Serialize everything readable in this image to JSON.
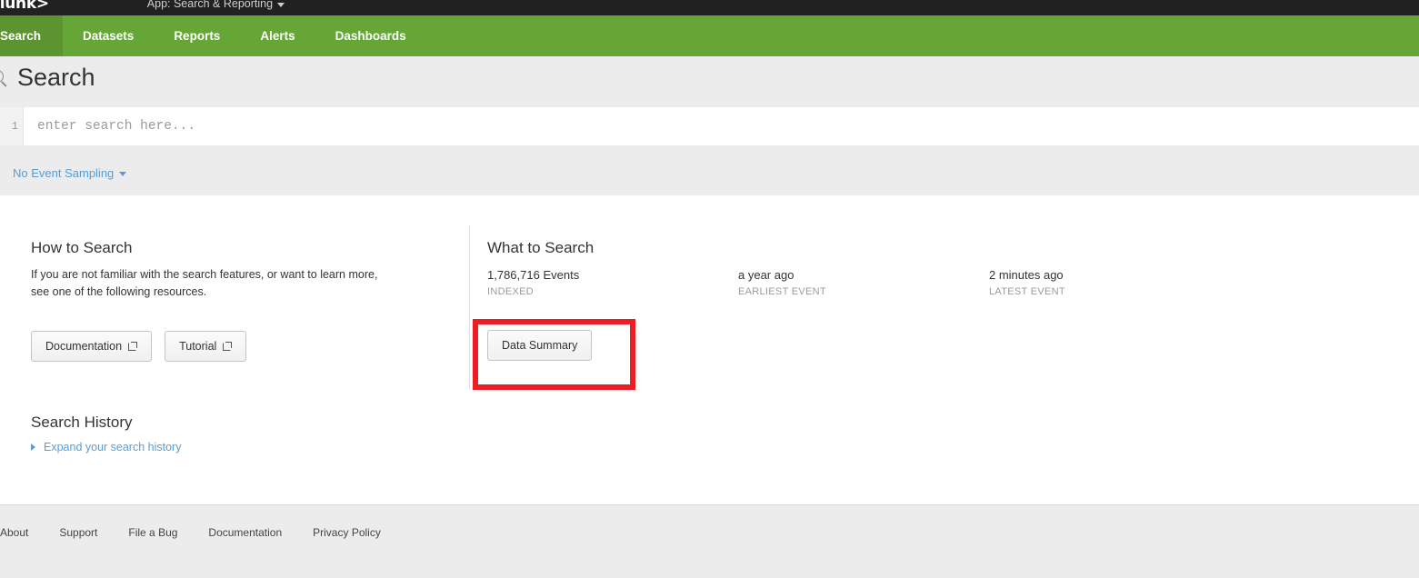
{
  "appbar": {
    "logo": "splunk>",
    "app_selector": "App: Search & Reporting"
  },
  "nav": {
    "items": [
      {
        "label": "Search",
        "active": true
      },
      {
        "label": "Datasets",
        "active": false
      },
      {
        "label": "Reports",
        "active": false
      },
      {
        "label": "Alerts",
        "active": false
      },
      {
        "label": "Dashboards",
        "active": false
      }
    ]
  },
  "page": {
    "title": "Search"
  },
  "search": {
    "line_number": "1",
    "placeholder": "enter search here...",
    "value": ""
  },
  "sampling": {
    "label": "No Event Sampling"
  },
  "how_to_search": {
    "title": "How to Search",
    "body": "If you are not familiar with the search features, or want to learn more, see one of the following resources.",
    "buttons": [
      {
        "label": "Documentation"
      },
      {
        "label": "Tutorial"
      }
    ]
  },
  "what_to_search": {
    "title": "What to Search",
    "stats": [
      {
        "value": "1,786,716 Events",
        "label": "INDEXED"
      },
      {
        "value": "a year ago",
        "label": "EARLIEST EVENT"
      },
      {
        "value": "2 minutes ago",
        "label": "LATEST EVENT"
      }
    ],
    "data_summary_label": "Data Summary",
    "highlight_color": "#EE1C25"
  },
  "search_history": {
    "title": "Search History",
    "expand_label": "Expand your search history"
  },
  "footer": {
    "links": [
      "About",
      "Support",
      "File a Bug",
      "Documentation",
      "Privacy Policy"
    ]
  },
  "colors": {
    "nav_green": "#65A637",
    "nav_green_active": "#5C9430",
    "appbar_dark": "#212121",
    "link_blue": "#5A9CD6",
    "band_gray": "#ECECEC"
  }
}
